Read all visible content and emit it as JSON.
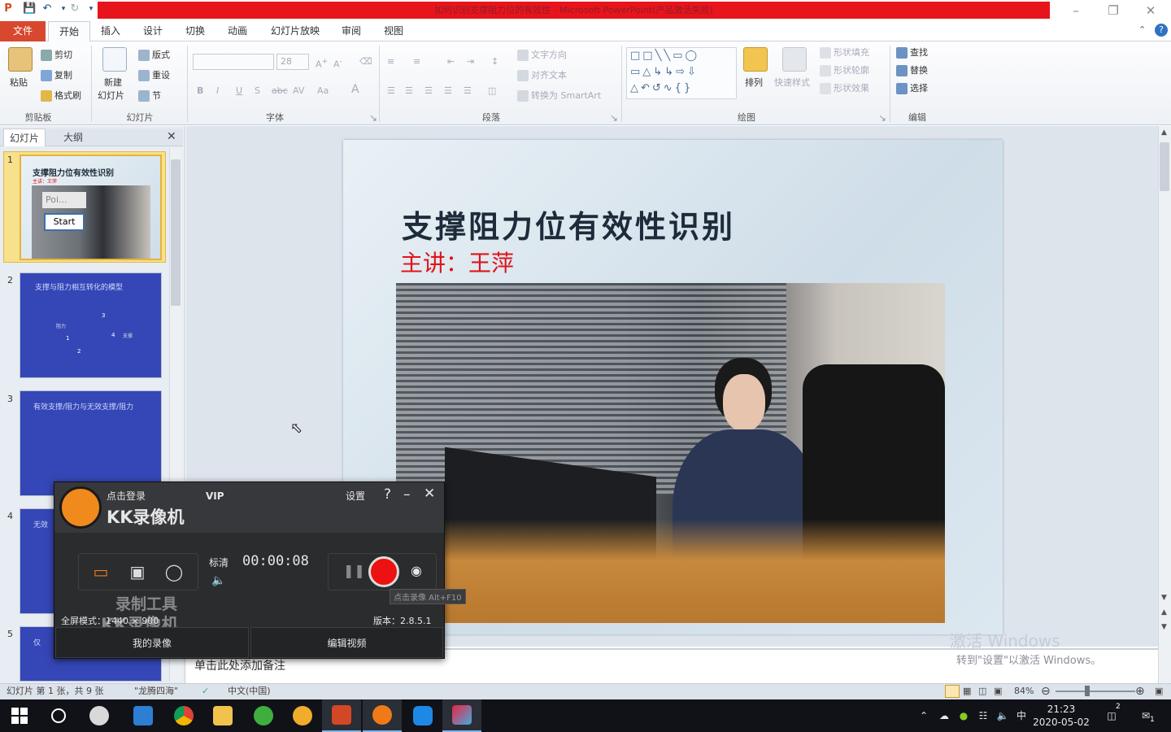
{
  "window": {
    "title": "如何识别支撑阻力位的有效性 - Microsoft PowerPoint(产品激活失败)"
  },
  "ribbon_tabs": [
    "文件",
    "开始",
    "插入",
    "设计",
    "切换",
    "动画",
    "幻灯片放映",
    "审阅",
    "视图"
  ],
  "ribbon": {
    "clipboard": {
      "paste": "粘贴",
      "cut": "剪切",
      "copy": "复制",
      "format_painter": "格式刷",
      "label": "剪贴板"
    },
    "slides": {
      "new_slide": "新建",
      "new_slide_2": "幻灯片",
      "layout": "版式",
      "reset": "重设",
      "section": "节",
      "label": "幻灯片"
    },
    "font": {
      "size": "28",
      "label": "字体"
    },
    "paragraph": {
      "text_direction": "文字方向",
      "align_text": "对齐文本",
      "smartart": "转换为 SmartArt",
      "label": "段落"
    },
    "drawing": {
      "arrange": "排列",
      "quick_styles": "快速样式",
      "shape_fill": "形状填充",
      "shape_outline": "形状轮廓",
      "shape_effects": "形状效果",
      "label": "绘图"
    },
    "editing": {
      "find": "查找",
      "replace": "替换",
      "select": "选择",
      "label": "编辑"
    }
  },
  "left_pane": {
    "tabs": [
      "幻灯片",
      "大纲"
    ],
    "thumbnails": [
      {
        "num": "1",
        "title": "支撑阻力位有效性识别",
        "sub": "主讲：王萍",
        "popup_text": "Poi...",
        "popup_button": "Start"
      },
      {
        "num": "2",
        "title": "支撑与阻力相互转化的模型",
        "labels": [
          "3",
          "阻力",
          "1",
          "4",
          "支撑",
          "2"
        ]
      },
      {
        "num": "3",
        "title": "有效支撑/阻力与无效支撑/阻力"
      },
      {
        "num": "4",
        "title": "无效"
      },
      {
        "num": "5",
        "title": "仅"
      }
    ]
  },
  "slide": {
    "title": "支撑阻力位有效性识别",
    "subtitle": "主讲：王萍"
  },
  "notes": {
    "placeholder": "单击此处添加备注"
  },
  "watermark": {
    "line1": "激活 Windows",
    "line2": "转到\"设置\"以激活 Windows。"
  },
  "status": {
    "slide_info": "幻灯片 第 1 张，共 9 张",
    "theme": "\"龙腾四海\"",
    "language": "中文(中国)",
    "zoom": "84%"
  },
  "kk_recorder": {
    "login": "点击登录",
    "vip": "VIP",
    "settings": "设置",
    "help": "?",
    "brand": "KK录像机",
    "quality": "标清",
    "timer": "00:00:08",
    "tooltip": "点击录像 Alt+F10",
    "watermark_line1": "录制工具",
    "watermark_line2": "KK录像机",
    "mode": "全屏模式：1440 × 900",
    "version": "版本：2.8.5.1",
    "my_recordings": "我的录像",
    "edit_video": "编辑视频"
  },
  "taskbar": {
    "time": "21:23",
    "date": "2020-05-02",
    "ime": "中",
    "notifications": "1",
    "tasks_badge": "2"
  },
  "colors": {
    "accent_red": "#e8141b",
    "file_tab": "#d8482f",
    "slide_title": "#1d2b3a",
    "subtitle_red": "#e0141a",
    "record": "#ee1111"
  }
}
